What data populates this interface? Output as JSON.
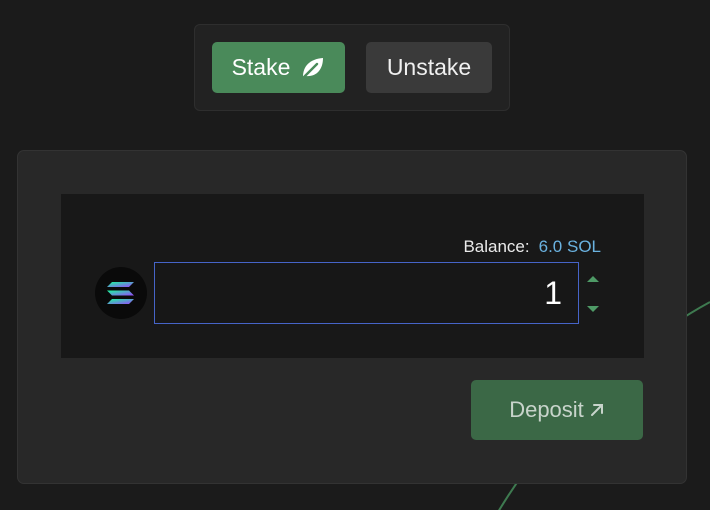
{
  "tabs": {
    "stake_label": "Stake",
    "unstake_label": "Unstake",
    "stake_icon": "leaf-icon",
    "active": "Stake"
  },
  "stake_form": {
    "balance_label": "Balance:",
    "balance_value": "6.0 SOL",
    "token_icon": "solana-logo-icon",
    "amount_value": "1",
    "stepper_icons": [
      "chevron-up-icon",
      "chevron-down-icon"
    ],
    "deposit_label": "Deposit",
    "deposit_icon": "arrow-up-right-icon"
  },
  "colors": {
    "background": "#1b1b1b",
    "accent_green": "#4a8a5a",
    "deposit_green": "#3b6846",
    "balance_blue": "#6ab2e0",
    "input_border": "#4664c8"
  }
}
